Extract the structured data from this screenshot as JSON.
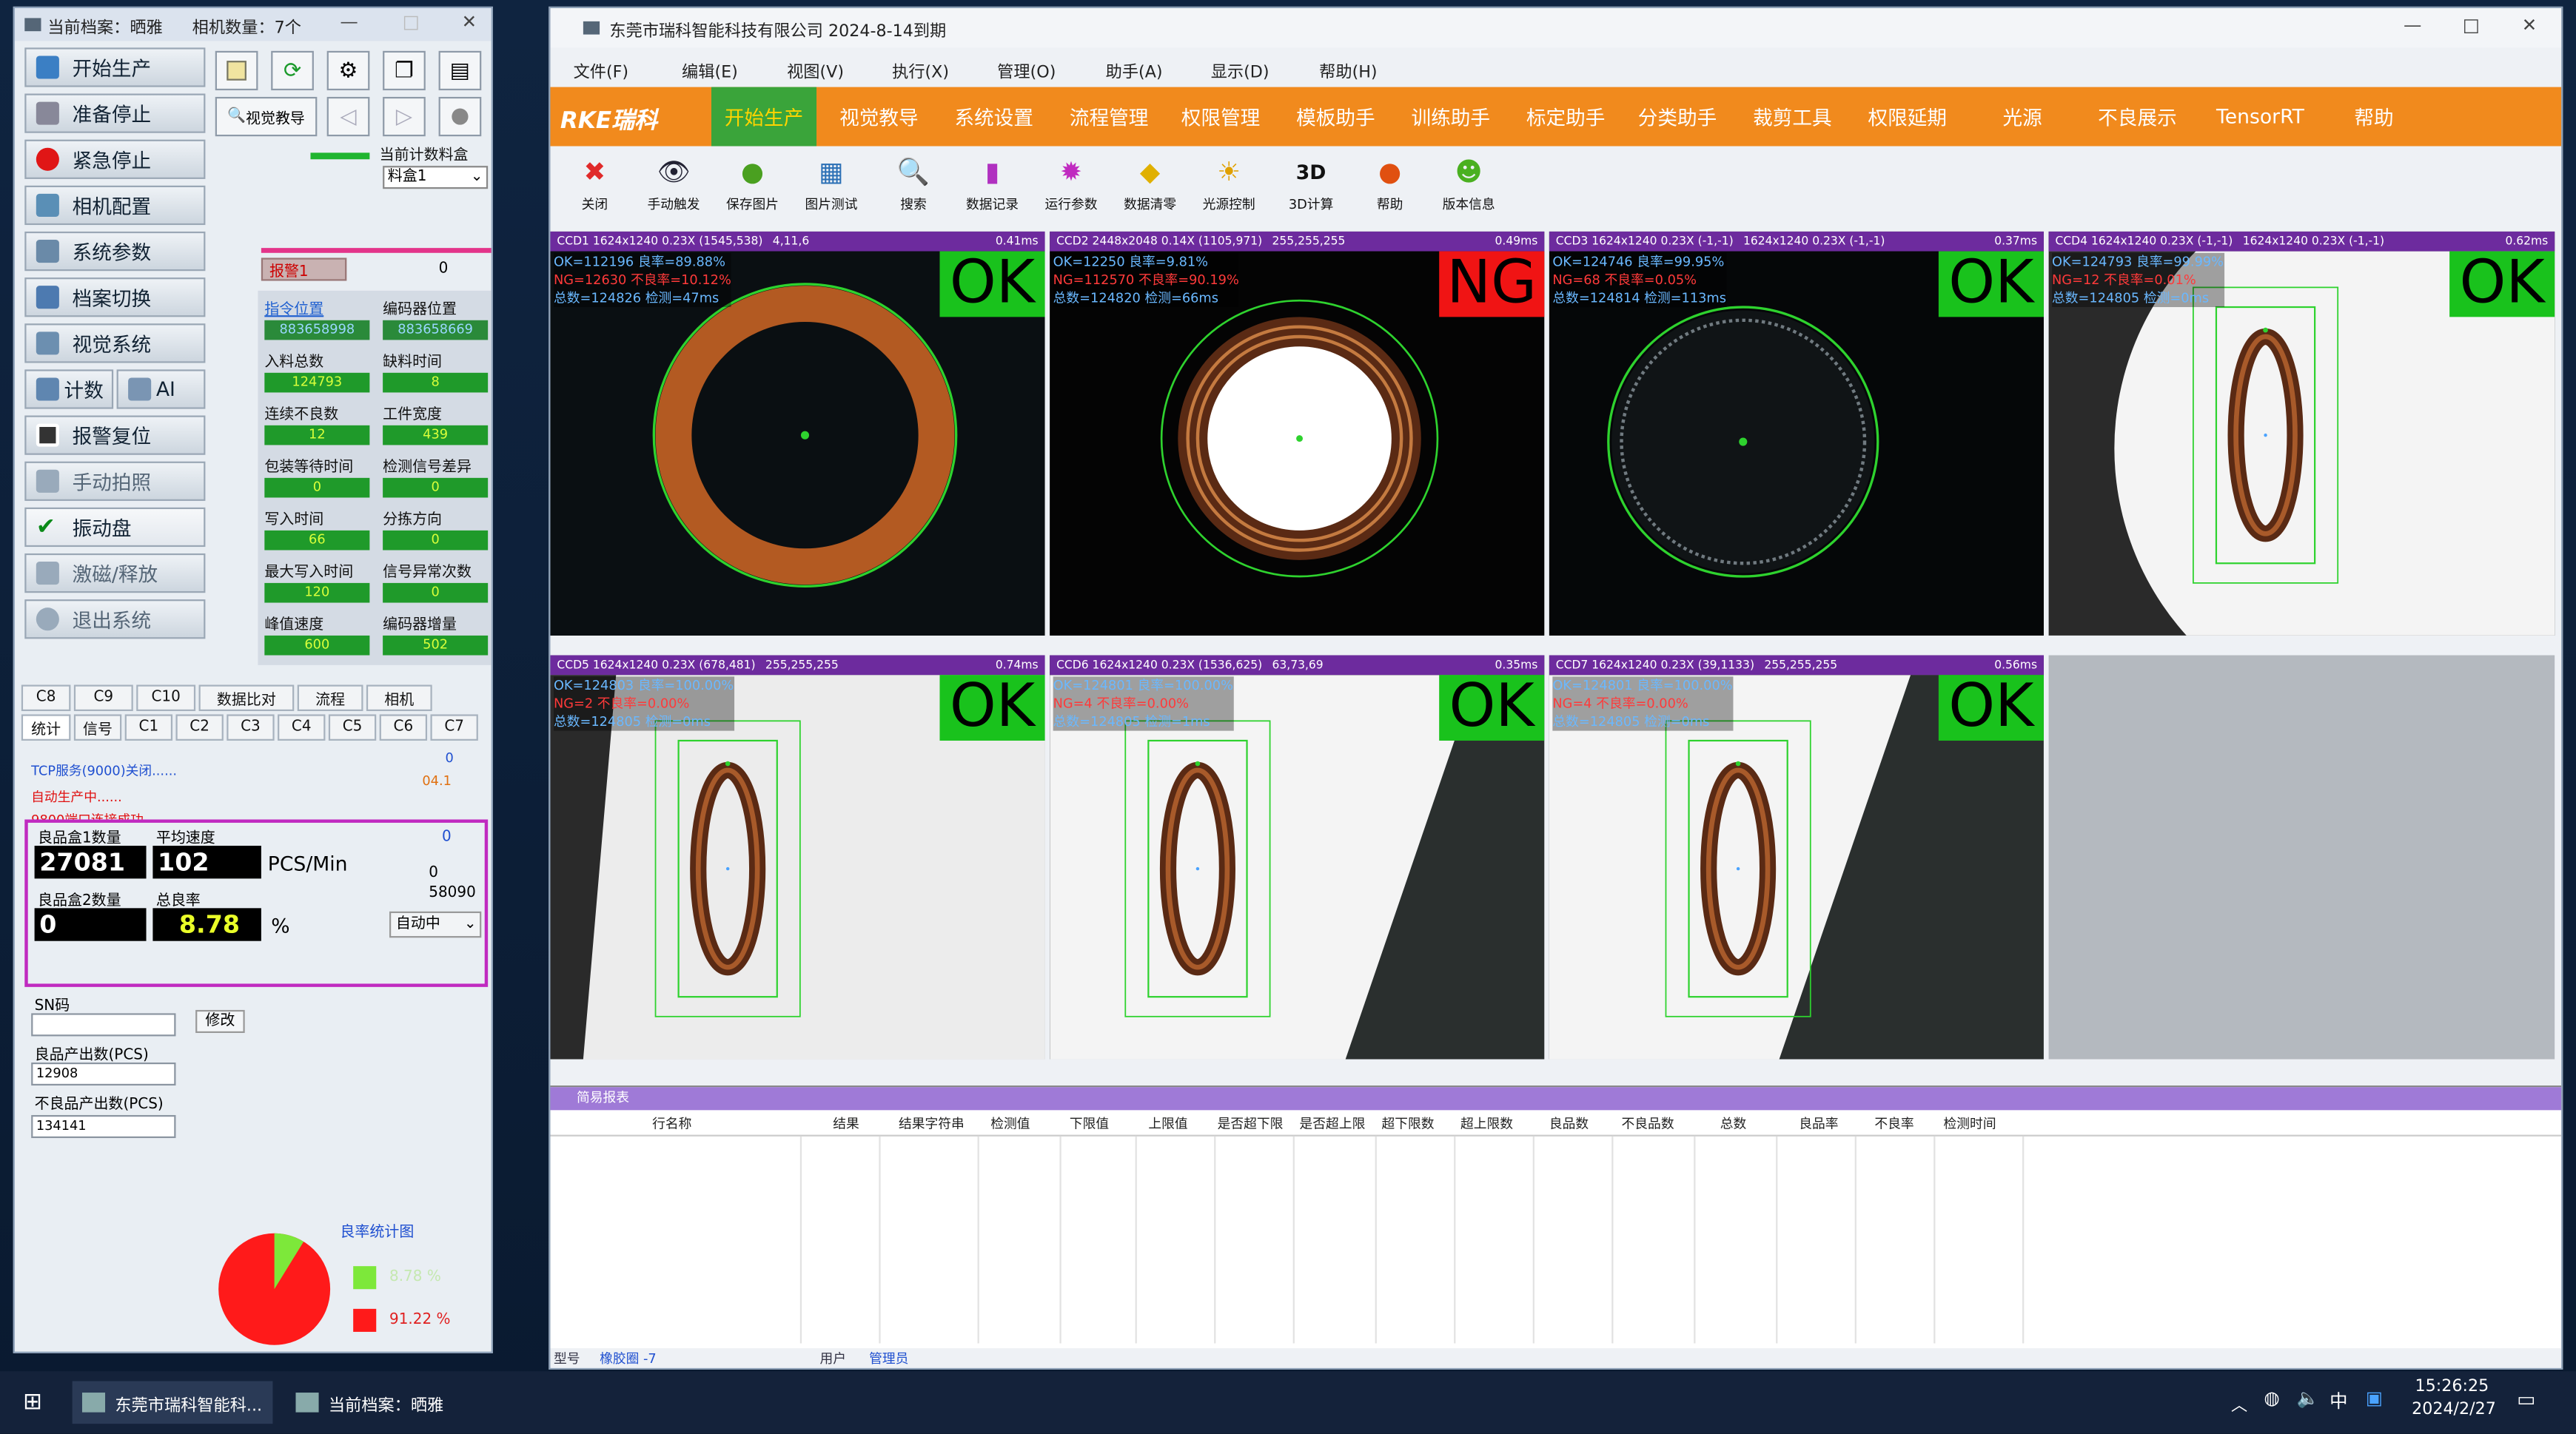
{
  "left_window": {
    "title": "当前档案：晒雅",
    "camera_count": "相机数量：7个",
    "buttons": [
      "开始生产",
      "准备停止",
      "紧急停止",
      "相机配置",
      "系统参数",
      "档案切换",
      "视觉系统",
      "计数",
      "AI",
      "报警复位",
      "手动拍照",
      "振动盘",
      "激磁/释放",
      "退出系统"
    ],
    "tool_label": "视觉教导",
    "count_material_label": "当前计数料盒",
    "count_material_value": "料盒1",
    "alarm_label": "报警1",
    "alarm_value": "0",
    "params": [
      {
        "label": "指令位置",
        "value": "883658998"
      },
      {
        "label": "编码器位置",
        "value": "883658669"
      },
      {
        "label": "入料总数",
        "value": "124793"
      },
      {
        "label": "缺料时间",
        "value": "8"
      },
      {
        "label": "连续不良数",
        "value": "12"
      },
      {
        "label": "工件宽度",
        "value": "439"
      },
      {
        "label": "包装等待时间",
        "value": "0"
      },
      {
        "label": "检测信号差异",
        "value": "0"
      },
      {
        "label": "写入时间",
        "value": "66"
      },
      {
        "label": "分拣方向",
        "value": "0"
      },
      {
        "label": "最大写入时间",
        "value": "120"
      },
      {
        "label": "信号异常次数",
        "value": "0"
      },
      {
        "label": "峰值速度",
        "value": "600"
      },
      {
        "label": "编码器增量",
        "value": "502"
      }
    ],
    "tabs_row1": [
      "C8",
      "C9",
      "C10",
      "数据比对",
      "流程",
      "相机"
    ],
    "tabs_row2": [
      "统计",
      "信号",
      "C1",
      "C2",
      "C3",
      "C4",
      "C5",
      "C6",
      "C7"
    ],
    "log": [
      {
        "text": "TCP服务(9000)关闭......",
        "num": "0"
      },
      {
        "text": "自动生产中......",
        "num": "04.1"
      },
      {
        "text": "9800端口连接成功 .....",
        "num": ""
      }
    ],
    "good_box1_label": "良品盒1数量",
    "avg_speed_label": "平均速度",
    "good_box1_value": "27081",
    "avg_speed_value": "102",
    "speed_unit": "PCS/Min",
    "right_zero": "0",
    "right_zero2": "0",
    "right_num": "58090",
    "good_box2_label": "良品盒2数量",
    "total_rate_label": "总良率",
    "good_box2_value": "0",
    "total_rate_value": "8.78",
    "percent": "%",
    "mode_value": "自动中",
    "sn_label": "SN码",
    "modify_label": "修改",
    "good_out_label": "良品产出数(PCS)",
    "good_out_value": "12908",
    "bad_out_label": "不良品产出数(PCS)",
    "bad_out_value": "134141",
    "pie_title": "良率统计图",
    "pie_good_pct": "8.78 %",
    "pie_bad_pct": "91.22 %",
    "pie_good_fraction": 0.0878,
    "pie_colors": {
      "good": "#7de83a",
      "bad": "#ff1a1a"
    }
  },
  "main_window": {
    "title": "东莞市瑞科智能科技有限公司 2024-8-14到期",
    "menu": [
      "文件(F)",
      "编辑(E)",
      "视图(V)",
      "执行(X)",
      "管理(O)",
      "助手(A)",
      "显示(D)",
      "帮助(H)"
    ],
    "logo": "RKE瑞科",
    "nav": [
      "开始生产",
      "视觉教导",
      "系统设置",
      "流程管理",
      "权限管理",
      "模板助手",
      "训练助手",
      "标定助手",
      "分类助手",
      "裁剪工具",
      "权限延期",
      "光源",
      "不良展示",
      "TensorRT",
      "帮助"
    ],
    "tools": [
      {
        "label": "关闭",
        "icon": "close-icon"
      },
      {
        "label": "手动触发",
        "icon": "eye-icon"
      },
      {
        "label": "保存图片",
        "icon": "save-image-icon"
      },
      {
        "label": "图片测试",
        "icon": "image-test-icon"
      },
      {
        "label": "搜索",
        "icon": "search-icon"
      },
      {
        "label": "数据记录",
        "icon": "data-record-icon"
      },
      {
        "label": "运行参数",
        "icon": "run-params-icon"
      },
      {
        "label": "数据清零",
        "icon": "data-clear-icon"
      },
      {
        "label": "光源控制",
        "icon": "light-control-icon"
      },
      {
        "label": "3D计算",
        "icon": "3d-icon"
      },
      {
        "label": "帮助",
        "icon": "help-icon"
      },
      {
        "label": "版本信息",
        "icon": "version-icon"
      }
    ],
    "cameras": [
      {
        "header": "CCD1 1624x1240 0.23X (1545,538)",
        "rgb": "4,11,6",
        "ms": "0.41ms",
        "ok": "OK=112196 良率=89.88%",
        "ng": "NG=12630 不良率=10.12%",
        "total": "总数=124826 检测=47ms",
        "result": "OK",
        "kind": "ring-dark-bg"
      },
      {
        "header": "CCD2 2448x2048 0.14X (1105,971)",
        "rgb": "255,255,255",
        "ms": "0.49ms",
        "ok": "OK=12250 良率=9.81%",
        "ng": "NG=112570 不良率=90.19%",
        "total": "总数=124820 检测=66ms",
        "result": "NG",
        "kind": "ring-white-center"
      },
      {
        "header": "CCD3 1624x1240 0.23X (-1,-1)",
        "rgb": "1624x1240 0.23X (-1,-1)",
        "ms": "0.37ms",
        "ok": "OK=124746 良率=99.95%",
        "ng": "NG=68 不良率=0.05%",
        "total": "总数=124814 检测=113ms",
        "result": "OK",
        "kind": "ring-dark"
      },
      {
        "header": "CCD4 1624x1240 0.23X (-1,-1)",
        "rgb": "1624x1240 0.23X (-1,-1)",
        "ms": "0.62ms",
        "ok": "OK=124793 良率=99.99%",
        "ng": "NG=12 不良率=0.01%",
        "total": "总数=124805 检测=0ms",
        "result": "OK",
        "kind": "ring-side-light"
      },
      {
        "header": "CCD5 1624x1240 0.23X (678,481)",
        "rgb": "255,255,255",
        "ms": "0.74ms",
        "ok": "OK=124803 良率=100.00%",
        "ng": "NG=2 不良率=0.00%",
        "total": "总数=124805 检测=0ms",
        "result": "OK",
        "kind": "ring-side-white"
      },
      {
        "header": "CCD6 1624x1240 0.23X (1536,625)",
        "rgb": "63,73,69",
        "ms": "0.35ms",
        "ok": "OK=124801 良率=100.00%",
        "ng": "NG=4 不良率=0.00%",
        "total": "总数=124805 检测=1ms",
        "result": "OK",
        "kind": "ring-side-shadow"
      },
      {
        "header": "CCD7 1624x1240 0.23X (39,1133)",
        "rgb": "255,255,255",
        "ms": "0.56ms",
        "ok": "OK=124801 良率=100.00%",
        "ng": "NG=4 不良率=0.00%",
        "total": "总数=124805 检测=0ms",
        "result": "OK",
        "kind": "ring-side-shadow2"
      }
    ],
    "report": {
      "title": "简易报表",
      "columns": [
        "行名称",
        "结果",
        "结果字符串",
        "检测值",
        "下限值",
        "上限值",
        "是否超下限",
        "是否超上限",
        "超下限数",
        "超上限数",
        "良品数",
        "不良品数",
        "总数",
        "良品率",
        "不良率",
        "检测时间"
      ]
    },
    "status_type_label": "型号",
    "status_type_value": "橡胶圈 -7",
    "status_user_label": "用户",
    "status_user_value": "管理员"
  },
  "taskbar": {
    "items": [
      "东莞市瑞科智能科...",
      "当前档案：晒雅"
    ],
    "ime": "中",
    "time": "15:26:25",
    "date": "2024/2/27"
  }
}
